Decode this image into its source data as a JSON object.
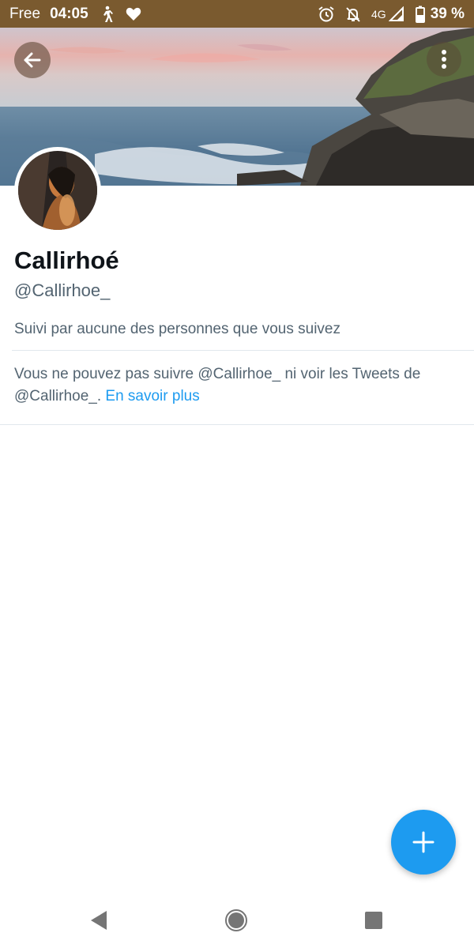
{
  "status_bar": {
    "carrier": "Free",
    "time": "04:05",
    "network": "4G",
    "battery": "39 %",
    "icons": [
      "walking-icon",
      "heart-icon",
      "alarm-icon",
      "notifications-off-icon",
      "signal-icon",
      "battery-icon"
    ]
  },
  "header": {
    "back_icon": "arrow-left-icon",
    "more_icon": "more-vertical-icon"
  },
  "profile": {
    "display_name": "Callirhoé",
    "handle": "@Callirhoe_",
    "followed_by": "Suivi par aucune des personnes que vous suivez"
  },
  "protected_notice": {
    "text": "Vous ne pouvez pas suivre @Callirhoe_ ni voir les Tweets de @Callirhoe_. ",
    "link": "En savoir plus"
  },
  "fab": {
    "icon": "plus-icon"
  },
  "nav_bar": {
    "icons": [
      "nav-back-icon",
      "nav-home-icon",
      "nav-recent-icon"
    ]
  },
  "colors": {
    "status_bar_bg": "#7a5a2f",
    "accent": "#1d9bf0",
    "secondary_text": "#536471",
    "primary_text": "#0f1419"
  }
}
